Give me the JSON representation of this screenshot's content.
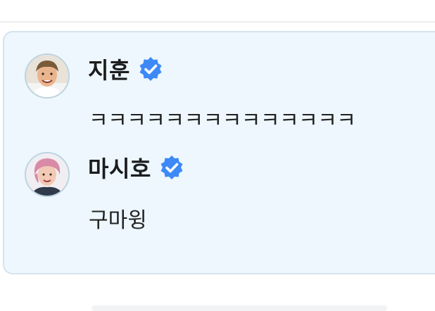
{
  "thread": {
    "posts": [
      {
        "author": "지훈",
        "verified": true,
        "message": "ㅋㅋㅋㅋㅋㅋㅋㅋㅋㅋㅋㅋㅋㅋ",
        "avatar_tone": "#d9a37a"
      },
      {
        "author": "마시호",
        "verified": true,
        "message": "구마윙",
        "avatar_tone": "#d98aa6"
      }
    ]
  },
  "colors": {
    "card_background": "#edf7fd",
    "card_border": "#d5e4ec",
    "verified_badge": "#3d8af7"
  },
  "icons": {
    "verified": "verified-badge-icon"
  }
}
